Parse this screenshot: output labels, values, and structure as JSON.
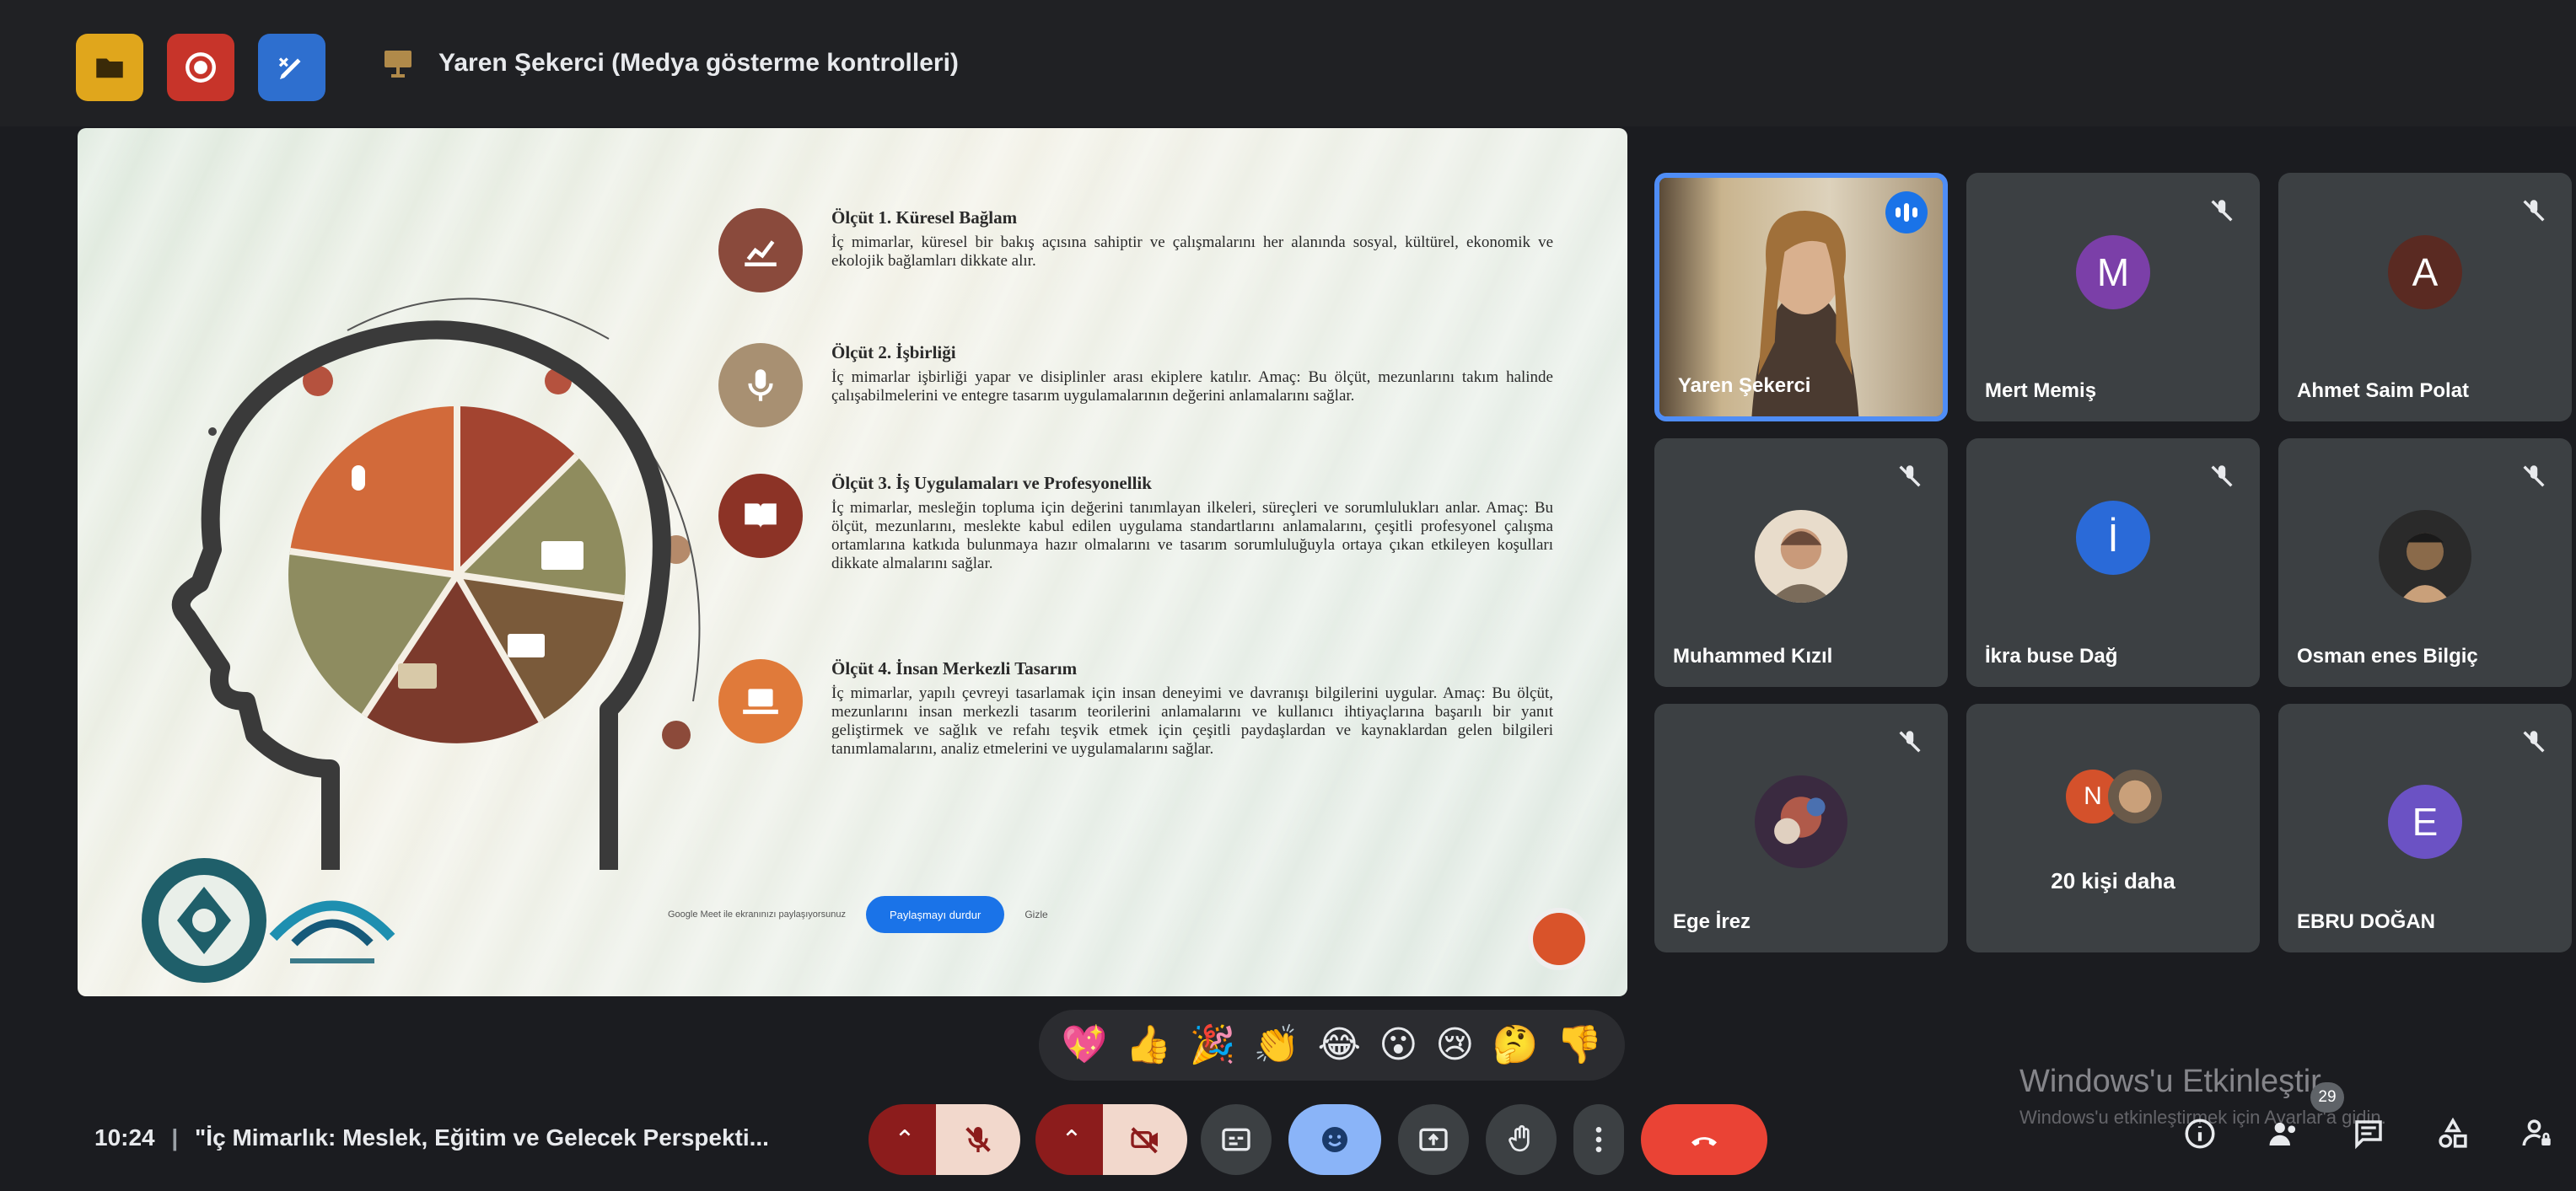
{
  "topbar": {
    "presenter_label": "Yaren Şekerci (Medya gösterme kontrolleri)",
    "colors": {
      "folder_btn": "#e0a61c",
      "record_btn": "#c7342a",
      "pen_btn": "#2e6fcf"
    }
  },
  "slide": {
    "criteria": [
      {
        "title": "Ölçüt 1. Küresel Bağlam",
        "text": "İç mimarlar, küresel bir bakış açısına sahiptir ve çalışmalarını her alanında sosyal, kültürel, ekonomik ve ekolojik bağlamları dikkate alır.",
        "icon": "chart-icon",
        "color": "#8a4a3c"
      },
      {
        "title": "Ölçüt 2. İşbirliği",
        "text": "İç mimarlar işbirliği yapar ve disiplinler arası ekiplere katılır. Amaç: Bu ölçüt, mezunlarını takım halinde çalışabilmelerini ve entegre tasarım uygulamalarının değerini anlamalarını sağlar.",
        "icon": "microphone-icon",
        "color": "#a89072"
      },
      {
        "title": "Ölçüt 3. İş Uygulamaları ve Profesyonellik",
        "text": "İç mimarlar, mesleğin topluma için değerini tanımlayan ilkeleri, süreçleri ve sorumlulukları anlar. Amaç: Bu ölçüt, mezunlarını, meslekte kabul edilen uygulama standartlarını anlamalarını, çeşitli profesyonel çalışma ortamlarına katkıda bulunmaya hazır olmalarını ve tasarım sorumluluğuyla ortaya çıkan etkileyen koşulları dikkate almalarını sağlar.",
        "icon": "book-icon",
        "color": "#8c3326"
      },
      {
        "title": "Ölçüt 4. İnsan Merkezli Tasarım",
        "text": "İç mimarlar, yapılı çevreyi tasarlamak için insan deneyimi ve davranışı bilgilerini uygular. Amaç: Bu ölçüt, mezunlarını insan merkezli tasarım teorilerini anlamalarını ve kullanıcı ihtiyaçlarına başarılı bir yanıt geliştirmek ve sağlık ve refahı teşvik etmek için çeşitli paydaşlardan ve kaynaklardan gelen bilgileri tanımlamalarını, analiz etmelerini ve uygulamalarını sağlar.",
        "icon": "laptop-icon",
        "color": "#e07a3a"
      }
    ],
    "share_notice": "Google Meet ile ekranınızı paylaşıyorsunuz",
    "share_button": "Paylaşmayı durdur",
    "share_hide": "Gizle"
  },
  "participants": [
    {
      "name": "Yaren Şekerci",
      "type": "video",
      "speaking": true
    },
    {
      "name": "Mert Memiş",
      "initial": "M",
      "color": "#7b3fa8",
      "muted": true
    },
    {
      "name": "Ahmet Saim Polat",
      "initial": "A",
      "color": "#5a2a22",
      "muted": true
    },
    {
      "name": "Muhammed Kızıl",
      "type": "photo",
      "muted": true
    },
    {
      "name": "İkra buse Dağ",
      "initial": "İ",
      "color": "#2a6ad8",
      "muted": true
    },
    {
      "name": "Osman enes Bilgiç",
      "type": "photo",
      "muted": true
    },
    {
      "name": "Ege İrez",
      "type": "photo",
      "muted": true
    },
    {
      "more": "20 kişi daha",
      "initial": "N",
      "color": "#d4512b"
    },
    {
      "name": "EBRU DOĞAN",
      "initial": "E",
      "color": "#6b52c4",
      "muted": true
    }
  ],
  "reactions": [
    "💖",
    "👍",
    "🎉",
    "👏",
    "😂",
    "😮",
    "😢",
    "🤔",
    "👎"
  ],
  "bottombar": {
    "time": "10:24",
    "separator": "|",
    "meeting_title": "\"İç Mimarlık: Meslek, Eğitim ve Gelecek Perspekti...",
    "participant_count": "29",
    "colors": {
      "end_call": "#ea4335",
      "danger_bg": "#8c1c1c",
      "active_blue": "#8ab4f8"
    }
  },
  "watermark": {
    "title": "Windows'u Etkinleştir",
    "subtitle": "Windows'u etkinleştirmek için Ayarlar'a gidin."
  }
}
